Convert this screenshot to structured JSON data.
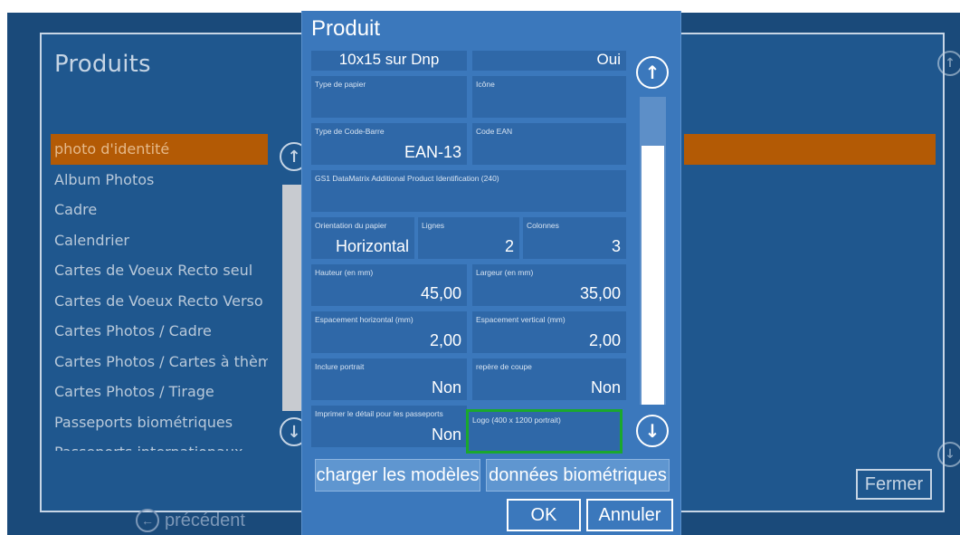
{
  "products_panel": {
    "title": "Produits",
    "items": [
      "photo d'identité",
      "Album Photos",
      "Cadre",
      "Calendrier",
      "Cartes de Voeux Recto seul",
      "Cartes de Voeux Recto Verso",
      "Cartes Photos / Cadre",
      "Cartes Photos / Cartes à thèmes",
      "Cartes Photos / Tirage",
      "Passeports biométriques",
      "Passeports internationaux"
    ],
    "selected_index": 0,
    "close_label": "Fermer",
    "previous_label": "précédent"
  },
  "dialog": {
    "title": "Produit",
    "fields": {
      "format": {
        "value": "10x15 sur Dnp"
      },
      "active": {
        "value": "Oui"
      },
      "paper_type": {
        "label": "Type de papier",
        "value": ""
      },
      "icon": {
        "label": "Icône",
        "value": ""
      },
      "barcode_type": {
        "label": "Type de Code-Barre",
        "value": "EAN-13"
      },
      "ean_code": {
        "label": "Code EAN",
        "value": ""
      },
      "gs1": {
        "label": "GS1 DataMatrix Additional Product Identification (240)",
        "value": ""
      },
      "orientation": {
        "label": "Orientation du papier",
        "value": "Horizontal"
      },
      "rows": {
        "label": "Lignes",
        "value": "2"
      },
      "columns": {
        "label": "Colonnes",
        "value": "3"
      },
      "height": {
        "label": "Hauteur (en mm)",
        "value": "45,00"
      },
      "width": {
        "label": "Largeur (en mm)",
        "value": "35,00"
      },
      "h_spacing": {
        "label": "Espacement horizontal (mm)",
        "value": "2,00"
      },
      "v_spacing": {
        "label": "Espacement vertical (mm)",
        "value": "2,00"
      },
      "include_portrait": {
        "label": "Inclure portrait",
        "value": "Non"
      },
      "cut_marks": {
        "label": "repère de coupe",
        "value": "Non"
      },
      "print_passport_detail": {
        "label": "Imprimer le détail pour les passeports",
        "value": "Non"
      },
      "logo": {
        "label": "Logo (400 x 1200 portrait)",
        "value": ""
      }
    },
    "load_models_label": "charger les modèles",
    "biometric_data_label": "données biométriques",
    "ok_label": "OK",
    "cancel_label": "Annuler"
  },
  "colors": {
    "app_bg": "#1a4a7a",
    "dialog_bg": "#3b78bc",
    "field_bg": "#2f68a8",
    "selection": "#b35a05",
    "highlight": "#1aa82d"
  }
}
